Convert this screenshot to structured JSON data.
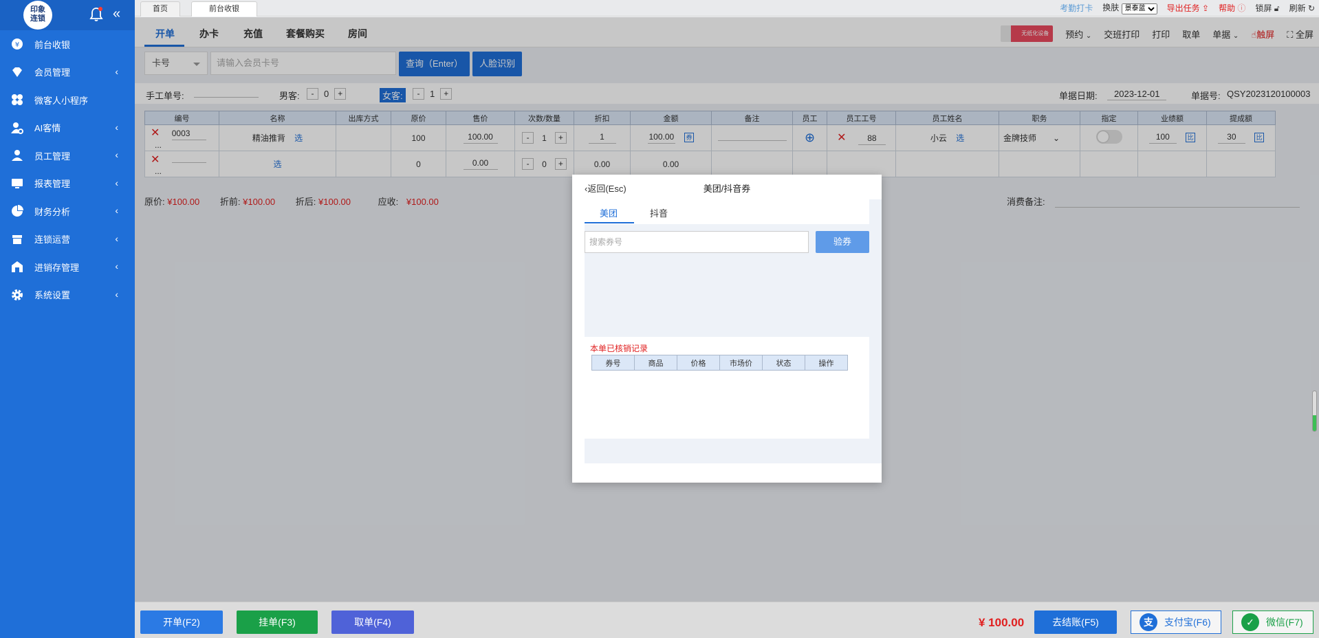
{
  "sidebar": {
    "logo_line1": "印象",
    "logo_line2": "连锁",
    "items": [
      {
        "label": "前台收银",
        "icon": "yen-coin-icon",
        "has_chevron": false
      },
      {
        "label": "会员管理",
        "icon": "diamond-icon",
        "has_chevron": true
      },
      {
        "label": "微客人小程序",
        "icon": "grid-circles-icon",
        "has_chevron": false
      },
      {
        "label": "AI客情",
        "icon": "user-gear-icon",
        "has_chevron": true
      },
      {
        "label": "员工管理",
        "icon": "person-icon",
        "has_chevron": true
      },
      {
        "label": "报表管理",
        "icon": "monitor-icon",
        "has_chevron": true
      },
      {
        "label": "财务分析",
        "icon": "pie-chart-icon",
        "has_chevron": true
      },
      {
        "label": "连锁运营",
        "icon": "store-icon",
        "has_chevron": true
      },
      {
        "label": "进销存管理",
        "icon": "warehouse-icon",
        "has_chevron": true
      },
      {
        "label": "系统设置",
        "icon": "gear-icon",
        "has_chevron": true
      }
    ]
  },
  "topbar": {
    "tabs": [
      "首页",
      "前台收银"
    ],
    "attendance": "考勤打卡",
    "switch_skin": "换肤",
    "skin_value": "景泰蓝",
    "export_task": "导出任务",
    "help": "帮助",
    "lock": "锁屏",
    "refresh": "刷新"
  },
  "subtabs": [
    "开单",
    "办卡",
    "充值",
    "套餐购买",
    "房间"
  ],
  "tools": {
    "promo": "无纸化设备",
    "items": [
      "预约",
      "交班打印",
      "打印",
      "取单",
      "单据",
      "触屏",
      "全屏"
    ]
  },
  "search": {
    "type": "卡号",
    "placeholder": "请输入会员卡号",
    "query_btn": "查询（Enter）",
    "face_btn": "人脸识别"
  },
  "info": {
    "manual_no_label": "手工单号:",
    "male_label": "男客:",
    "male_count": "0",
    "female_label": "女客:",
    "female_count": "1",
    "date_label": "单据日期:",
    "date_value": "2023-12-01",
    "order_no_label": "单据号:",
    "order_no": "QSY2023120100003"
  },
  "table": {
    "headers": [
      "编号",
      "名称",
      "出库方式",
      "原价",
      "售价",
      "次数/数量",
      "折扣",
      "金额",
      "备注",
      "员工",
      "员工工号",
      "员工姓名",
      "职务",
      "指定",
      "业绩额",
      "提成额"
    ],
    "row1": {
      "code": "0003",
      "dots": "...",
      "name": "精油推背",
      "select": "选",
      "orig": "100",
      "price": "100.00",
      "qty": "1",
      "discount": "1",
      "amount": "100.00",
      "coupon": "券",
      "emp_no": "88",
      "emp_name": "小云",
      "emp_select": "选",
      "position": "金牌技师",
      "perf": "100",
      "commission": "30",
      "pct": "比"
    },
    "row2": {
      "dots": "...",
      "select": "选",
      "orig": "0",
      "price": "0.00",
      "qty": "0",
      "discount": "0.00",
      "amount": "0.00"
    }
  },
  "summary": {
    "orig_label": "原价:",
    "orig_value": "¥100.00",
    "before_label": "折前:",
    "before_value": "¥100.00",
    "after_label": "折后:",
    "after_value": "¥100.00",
    "due_label": "应收:",
    "due_value": "¥100.00",
    "notes_label": "消费备注:"
  },
  "bottom": {
    "open": "开单(F2)",
    "hold": "挂单(F3)",
    "fetch": "取单(F4)",
    "total": "¥ 100.00",
    "checkout": "去结账(F5)",
    "alipay_icon_char": "支",
    "alipay": "支付宝(F6)",
    "wechat": "微信(F7)"
  },
  "dialog": {
    "back": "返回(Esc)",
    "title": "美团/抖音券",
    "tabs": [
      "美团",
      "抖音"
    ],
    "search_placeholder": "搜索券号",
    "verify_btn": "验券",
    "records_title": "本单已核销记录",
    "records_headers": [
      "券号",
      "商品",
      "价格",
      "市场价",
      "状态",
      "操作"
    ]
  },
  "colors": {
    "sidebar": "#1f6fd8",
    "accent": "#1f6fd8",
    "price_red": "#e02020",
    "hold_green": "#1aa048",
    "fetch_purple": "#4f62d8"
  }
}
